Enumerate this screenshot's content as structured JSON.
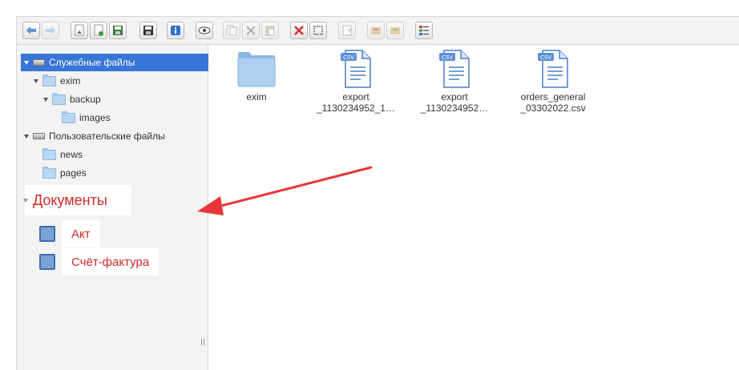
{
  "toolbar": {
    "buttons": [
      {
        "name": "back-button",
        "icon": "arrow-left-icon",
        "enabled": true
      },
      {
        "name": "forward-button",
        "icon": "arrow-right-icon",
        "enabled": false
      },
      {
        "name": "upload-button",
        "icon": "upload-icon",
        "enabled": true
      },
      {
        "name": "new-file-button",
        "icon": "new-file-icon",
        "enabled": true
      },
      {
        "name": "save-green-button",
        "icon": "save-green-icon",
        "enabled": true
      },
      {
        "name": "save-button",
        "icon": "floppy-icon",
        "enabled": true
      },
      {
        "name": "info-button",
        "icon": "info-icon",
        "enabled": true
      },
      {
        "name": "preview-button",
        "icon": "eye-icon",
        "enabled": true
      },
      {
        "name": "copy-button",
        "icon": "copy-icon",
        "enabled": false
      },
      {
        "name": "cut-button",
        "icon": "scissors-icon",
        "enabled": false
      },
      {
        "name": "paste-button",
        "icon": "paste-icon",
        "enabled": false
      },
      {
        "name": "delete-button",
        "icon": "delete-x-icon",
        "enabled": true
      },
      {
        "name": "select-button",
        "icon": "select-frame-icon",
        "enabled": true
      },
      {
        "name": "edit-button",
        "icon": "edit-file-icon",
        "enabled": false
      },
      {
        "name": "extract-button",
        "icon": "extract-icon",
        "enabled": false
      },
      {
        "name": "archive-button",
        "icon": "archive-icon",
        "enabled": false
      },
      {
        "name": "view-list-button",
        "icon": "list-view-icon",
        "enabled": true
      }
    ]
  },
  "tree": {
    "system_files": "Служебные файлы",
    "exim": "exim",
    "backup": "backup",
    "images": "images",
    "user_files": "Пользовательские файлы",
    "news": "news",
    "pages": "pages"
  },
  "documents": {
    "title": "Документы",
    "items": [
      "Акт",
      "Счёт-фактура"
    ]
  },
  "files": [
    {
      "name": "exim",
      "type": "folder"
    },
    {
      "name": "export\n_1130234952_1…",
      "type": "csv"
    },
    {
      "name": "export\n_1130234952…",
      "type": "csv"
    },
    {
      "name": "orders_general\n_03302022.csv",
      "type": "csv"
    }
  ],
  "file_badge": "CSV",
  "colors": {
    "selection": "#3875d7",
    "document_text": "#d02a2a",
    "arrow": "#e8363a",
    "folder": "#b9d7f2",
    "csv_badge": "#5b8fd4"
  }
}
